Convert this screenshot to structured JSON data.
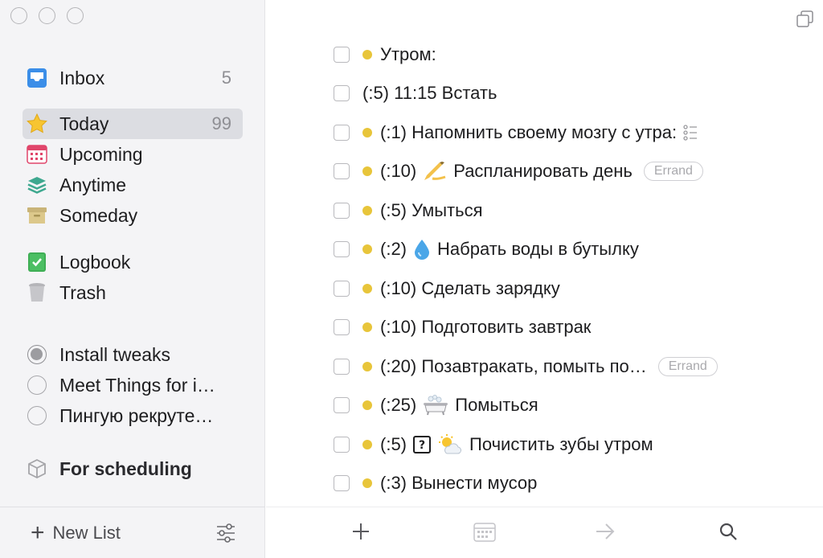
{
  "window": {
    "controls": [
      "close",
      "minimize",
      "zoom"
    ]
  },
  "sidebar": {
    "inbox": {
      "label": "Inbox",
      "count": "5",
      "icon": "inbox-icon"
    },
    "nav": [
      {
        "label": "Today",
        "count": "99",
        "icon": "star-icon",
        "selected": true
      },
      {
        "label": "Upcoming",
        "icon": "calendar-icon"
      },
      {
        "label": "Anytime",
        "icon": "layers-icon"
      },
      {
        "label": "Someday",
        "icon": "archive-box-icon"
      }
    ],
    "logbook": {
      "label": "Logbook",
      "icon": "logbook-icon"
    },
    "trash": {
      "label": "Trash",
      "icon": "trash-icon"
    },
    "projects": [
      {
        "label": "Install tweaks",
        "icon": "project-progress-icon"
      },
      {
        "label": "Meet Things for i…",
        "icon": "project-circle-icon"
      },
      {
        "label": "Пингую рекруте…",
        "icon": "project-circle-icon"
      }
    ],
    "area": {
      "label": "For scheduling",
      "icon": "area-cube-icon"
    },
    "footer": {
      "new_list_label": "New List",
      "plus": "+"
    }
  },
  "colors": {
    "accent_dot": "#e8c53a",
    "selection": "#dcdde2",
    "sidebar_bg": "#f4f4f6"
  },
  "tasks": [
    {
      "title": "Утром:",
      "dot": true
    },
    {
      "title": "(:5) 11:15 Встать",
      "dot": false
    },
    {
      "title": "(:1) Напомнить своему мозгу с утра:",
      "dot": true,
      "checklist": true
    },
    {
      "title_pre": "(:10)",
      "emoji": "writing-hand-icon",
      "title": "Распланировать день",
      "dot": true,
      "tag": "Errand"
    },
    {
      "title": "(:5) Умыться",
      "dot": true
    },
    {
      "title_pre": "(:2)",
      "emoji": "droplet-icon",
      "title": "Набрать воды в бутылку",
      "dot": true
    },
    {
      "title": "(:10) Сделать зарядку",
      "dot": true
    },
    {
      "title": "(:10) Подготовить завтрак",
      "dot": true
    },
    {
      "title": "(:20) Позавтракать, помыть по…",
      "dot": true,
      "tag": "Errand"
    },
    {
      "title_pre": "(:25)",
      "emoji": "bathtub-icon",
      "title": "Помыться",
      "dot": true
    },
    {
      "title_pre": "(:5)",
      "emoji": "question-box-icon",
      "emoji2": "sun-cloud-icon",
      "title": "Почистить зубы утром",
      "dot": true
    },
    {
      "title": "(:3) Вынести мусор",
      "dot": true
    }
  ],
  "toolbar": {
    "add": "add-task-icon",
    "when": "calendar-icon",
    "move": "arrow-right-icon",
    "search": "search-icon"
  }
}
